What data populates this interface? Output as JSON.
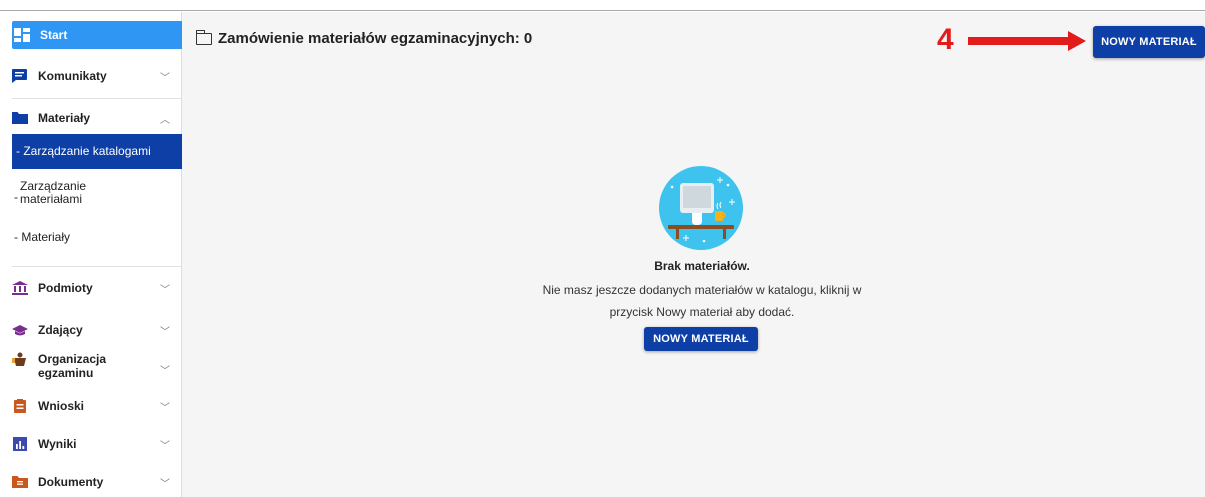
{
  "page": {
    "title": "Zamówienie materiałów egzaminacyjnych: 0",
    "new_material_button": "NOWY MATERIAŁ",
    "annotation_number": "4"
  },
  "sidebar": {
    "start": "Start",
    "komunikaty": "Komunikaty",
    "materialy": "Materiały",
    "sub_catalogs": "- Zarządzanie katalogami",
    "sub_materials_dash": "-",
    "sub_materials_line1": "Zarządzanie",
    "sub_materials_line2": "materiałami",
    "sub_materialy": "- Materiały",
    "podmioty": "Podmioty",
    "zdajacy": "Zdający",
    "organizacja_line1": "Organizacja",
    "organizacja_line2": "egzaminu",
    "wnioski": "Wnioski",
    "wyniki": "Wyniki",
    "dokumenty": "Dokumenty"
  },
  "empty_state": {
    "title": "Brak materiałów.",
    "desc_line1": "Nie masz jeszcze dodanych materiałów w katalogu, kliknij w",
    "desc_line2": "przycisk Nowy materiał aby dodać.",
    "button": "NOWY MATERIAŁ"
  },
  "colors": {
    "primary": "#0d3fa6",
    "start_bg": "#2f96f3",
    "annotation": "#e21b1b",
    "illustration_circle": "#3ec3ee"
  },
  "icons": {
    "start": "dashboard-icon",
    "komunikaty": "message-icon",
    "materialy": "folder-icon",
    "podmioty": "institution-icon",
    "zdajacy": "graduation-cap-icon",
    "organizacja": "person-desk-icon",
    "wnioski": "clipboard-icon",
    "wyniki": "bar-chart-icon",
    "dokumenty": "document-folder-icon"
  }
}
